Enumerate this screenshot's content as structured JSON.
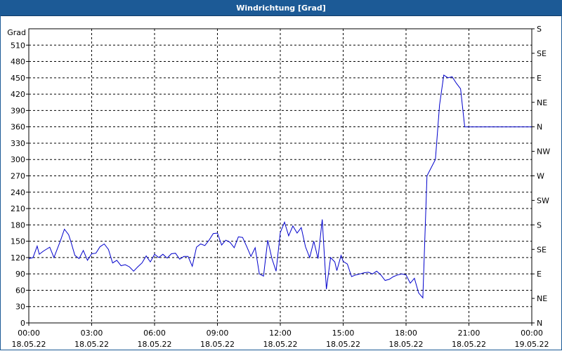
{
  "window": {
    "title": "Windrichtung [Grad]"
  },
  "colors": {
    "titlebar": "#1c5a96",
    "line": "#0000cc",
    "grid": "#000000"
  },
  "chart_data": {
    "type": "line",
    "title": "Windrichtung [Grad]",
    "ylabel": "Grad",
    "xlabel": "",
    "ylim": [
      0,
      540
    ],
    "yticks": [
      0,
      30,
      60,
      90,
      120,
      150,
      180,
      210,
      240,
      270,
      300,
      330,
      360,
      390,
      420,
      450,
      480,
      510
    ],
    "right_axis_labels": [
      "N",
      "NE",
      "E",
      "SE",
      "S",
      "SW",
      "W",
      "NW",
      "N",
      "NE",
      "E",
      "SE",
      "S"
    ],
    "right_axis_values": [
      0,
      45,
      90,
      135,
      180,
      225,
      270,
      315,
      360,
      405,
      450,
      495,
      540
    ],
    "xlim": [
      0,
      24
    ],
    "xticks": [
      {
        "t": 0,
        "time": "00:00",
        "date": "18.05.22"
      },
      {
        "t": 3,
        "time": "03:00",
        "date": "18.05.22"
      },
      {
        "t": 6,
        "time": "06:00",
        "date": "18.05.22"
      },
      {
        "t": 9,
        "time": "09:00",
        "date": "18.05.22"
      },
      {
        "t": 12,
        "time": "12:00",
        "date": "18.05.22"
      },
      {
        "t": 15,
        "time": "15:00",
        "date": "18.05.22"
      },
      {
        "t": 18,
        "time": "18:00",
        "date": "18.05.22"
      },
      {
        "t": 21,
        "time": "21:00",
        "date": "18.05.22"
      },
      {
        "t": 24,
        "time": "00:00",
        "date": "19.05.22"
      }
    ],
    "grid": true,
    "series": [
      {
        "x": [
          0,
          0.2,
          0.4,
          0.5,
          0.7,
          1.0,
          1.2,
          1.5,
          1.7,
          1.9,
          2.0,
          2.2,
          2.4,
          2.6,
          2.8,
          3.0,
          3.2,
          3.4,
          3.6,
          3.8,
          4.0,
          4.2,
          4.4,
          4.6,
          4.8,
          5.0,
          5.2,
          5.4,
          5.6,
          5.8,
          6.0,
          6.2,
          6.4,
          6.6,
          6.8,
          7.0,
          7.2,
          7.4,
          7.6,
          7.8,
          8.0,
          8.2,
          8.4,
          8.6,
          8.8,
          9.0,
          9.2,
          9.4,
          9.6,
          9.8,
          10.0,
          10.2,
          10.4,
          10.6,
          10.8,
          11.0,
          11.2,
          11.4,
          11.6,
          11.8,
          12.0,
          12.2,
          12.4,
          12.6,
          12.8,
          13.0,
          13.2,
          13.4,
          13.6,
          13.8,
          14.0,
          14.2,
          14.4,
          14.6,
          14.7,
          14.9,
          15.0,
          15.2,
          15.4,
          15.6,
          15.8,
          16.0,
          16.2,
          16.4,
          16.6,
          16.8,
          17.0,
          17.2,
          17.4,
          17.6,
          17.8,
          18.0,
          18.2,
          18.4,
          18.6,
          18.8,
          19.0,
          19.2,
          19.4,
          19.6,
          19.8,
          20.0,
          20.2,
          20.4,
          20.6,
          20.8,
          21.0,
          21.3,
          21.6,
          22.0,
          22.5,
          23.0,
          23.5,
          24.0
        ],
        "values": [
          118,
          120,
          141,
          126,
          132,
          139,
          120,
          150,
          172,
          162,
          150,
          124,
          118,
          133,
          115,
          127,
          128,
          140,
          145,
          135,
          110,
          115,
          105,
          107,
          103,
          95,
          103,
          110,
          123,
          112,
          126,
          120,
          126,
          119,
          127,
          128,
          117,
          122,
          122,
          104,
          139,
          145,
          142,
          152,
          164,
          165,
          143,
          152,
          148,
          138,
          158,
          157,
          140,
          122,
          138,
          90,
          86,
          152,
          118,
          95,
          166,
          185,
          160,
          178,
          165,
          175,
          140,
          120,
          150,
          118,
          190,
          62,
          120,
          112,
          96,
          124,
          113,
          108,
          85,
          88,
          90,
          92,
          93,
          90,
          95,
          88,
          78,
          80,
          85,
          88,
          90,
          88,
          73,
          82,
          55,
          46,
          270,
          285,
          300,
          400,
          455,
          450,
          452,
          440,
          430,
          360,
          360,
          360,
          360,
          360,
          360,
          360,
          360,
          360
        ]
      }
    ]
  }
}
